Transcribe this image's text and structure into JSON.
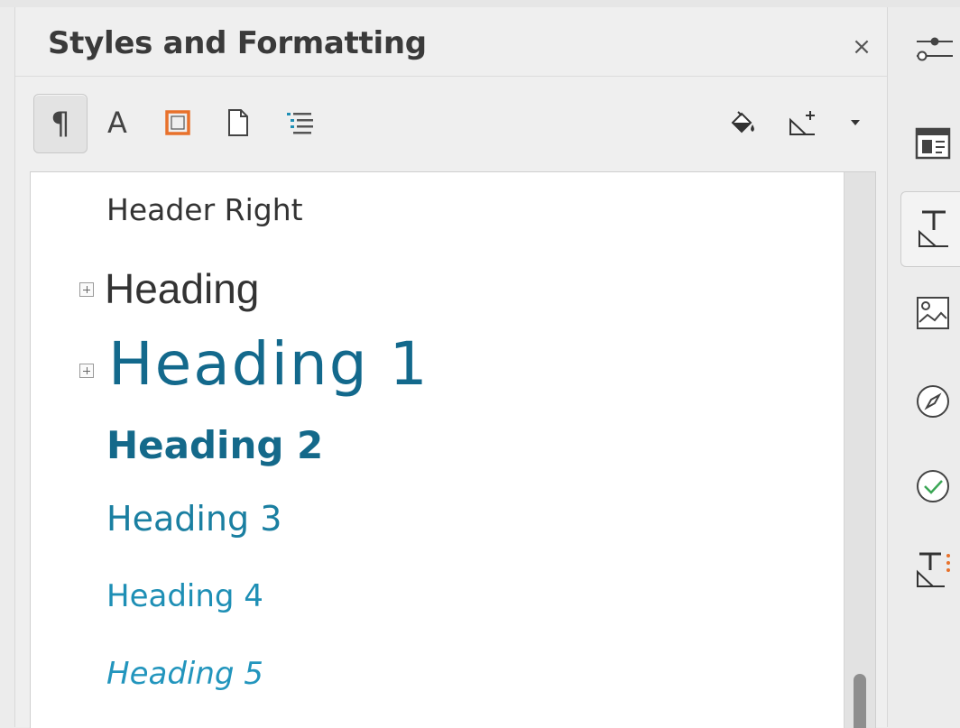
{
  "panel": {
    "title": "Styles and Formatting",
    "close_glyph": "×"
  },
  "toolbar": {
    "paragraph_glyph": "¶",
    "character_glyph": "A",
    "icons": [
      "paragraph-styles-icon",
      "character-styles-icon",
      "frame-styles-icon",
      "page-styles-icon",
      "list-styles-icon",
      "fill-format-mode-icon",
      "new-style-from-selection-icon",
      "chevron-down-icon"
    ]
  },
  "styles": [
    {
      "label": "Header Right",
      "expandable": false
    },
    {
      "label": "Heading",
      "expandable": true
    },
    {
      "label": "Heading 1",
      "expandable": true
    },
    {
      "label": "Heading 2",
      "expandable": false
    },
    {
      "label": "Heading 3",
      "expandable": false
    },
    {
      "label": "Heading 4",
      "expandable": false
    },
    {
      "label": "Heading 5",
      "expandable": false
    }
  ],
  "sidebar_deck": {
    "items": [
      "properties-icon",
      "page-icon",
      "styles-icon",
      "gallery-icon",
      "navigator-icon",
      "manage-changes-icon",
      "style-inspector-icon"
    ],
    "active": "styles-icon"
  },
  "colors": {
    "frame_accent": "#e8712b",
    "heading_blue": "#13698c",
    "check_green": "#3aa655",
    "inspector_dots": "#e8712b"
  }
}
